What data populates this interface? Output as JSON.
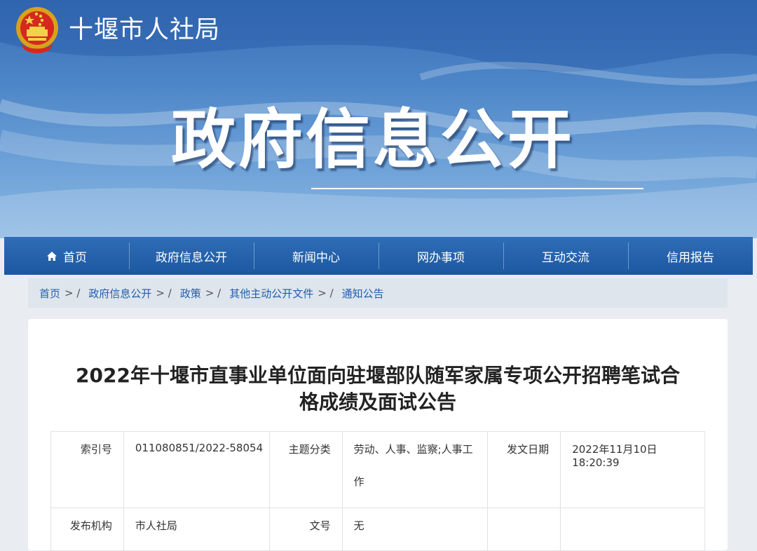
{
  "site": {
    "title": "十堰市人社局",
    "hero": "政府信息公开",
    "colors": {
      "banner": "#4d86c8",
      "nav": "#2462ab",
      "link": "#1e5fae"
    }
  },
  "nav": [
    {
      "label": "首页",
      "icon": "home-icon"
    },
    {
      "label": "政府信息公开"
    },
    {
      "label": "新闻中心"
    },
    {
      "label": "网办事项"
    },
    {
      "label": "互动交流"
    },
    {
      "label": "信用报告"
    }
  ],
  "breadcrumb": [
    "首页",
    "政府信息公开",
    "政策",
    "其他主动公开文件",
    "通知公告"
  ],
  "article": {
    "title_line1": "2022年十堰市直事业单位面向驻堰部队随军家属专项公开招聘笔试合",
    "title_line2": "格成绩及面试公告"
  },
  "meta": {
    "index_label": "索引号",
    "index_value": "011080851/2022-58054",
    "topic_label": "主题分类",
    "topic_value": "劳动、人事、监察;人事工作",
    "date_label": "发文日期",
    "date_value": "2022年11月10日 18:20:39",
    "issuer_label": "发布机构",
    "issuer_value": "市人社局",
    "docno_label": "文号",
    "docno_value": "无"
  }
}
